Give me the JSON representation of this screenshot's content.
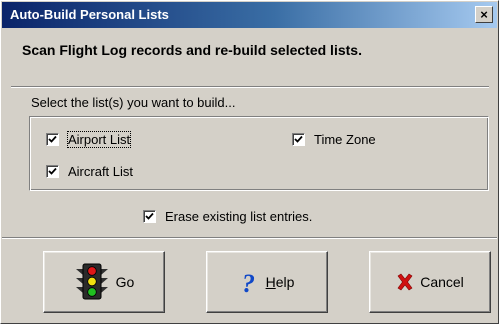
{
  "window": {
    "title": "Auto-Build Personal Lists",
    "close_label": "×"
  },
  "heading": "Scan Flight Log records and re-build selected lists.",
  "instruction": "Select the list(s) you want to build...",
  "lists": {
    "airport": {
      "label": "Airport List",
      "checked": true
    },
    "time_zone": {
      "label": "Time Zone",
      "checked": true
    },
    "aircraft": {
      "label": "Aircraft List",
      "checked": true
    }
  },
  "erase": {
    "label": "Erase existing list entries.",
    "checked": true
  },
  "buttons": {
    "go": {
      "label": "Go",
      "icon": "traffic-light-icon"
    },
    "help": {
      "label_pre": "",
      "label_hotkey": "H",
      "label_post": "elp",
      "icon": "question-mark-icon"
    },
    "cancel": {
      "label": "Cancel",
      "icon": "red-x-icon"
    }
  },
  "colors": {
    "titlebar_start": "#0a246a",
    "titlebar_end": "#a6caf0",
    "dialog_face": "#d4d0c8",
    "help_icon": "#1048c8",
    "cancel_icon": "#d01010"
  }
}
